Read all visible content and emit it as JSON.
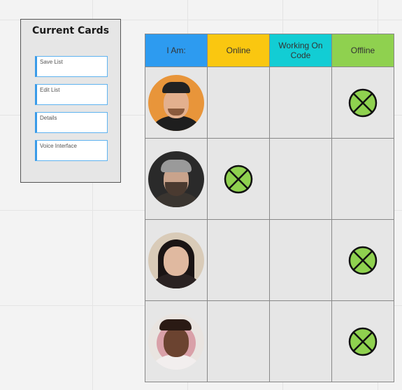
{
  "panel": {
    "title": "Current Cards",
    "cards": [
      "Save List",
      "Edit List",
      "Details",
      "Voice Interface"
    ]
  },
  "table": {
    "headers": [
      "I Am:",
      "Online",
      "Working On Code",
      "Offline"
    ],
    "header_colors": [
      "#2d9bf0",
      "#fac710",
      "#12cdd4",
      "#8fd14f"
    ],
    "rows": [
      {
        "avatar": "person-1-photo",
        "status_column": "Offline"
      },
      {
        "avatar": "person-2-photo",
        "status_column": "Online"
      },
      {
        "avatar": "person-3-photo",
        "status_column": "Offline"
      },
      {
        "avatar": "person-4-photo",
        "status_column": "Offline"
      }
    ],
    "marker_icon": "x-circle-icon",
    "marker_color": "#8fd14f"
  }
}
